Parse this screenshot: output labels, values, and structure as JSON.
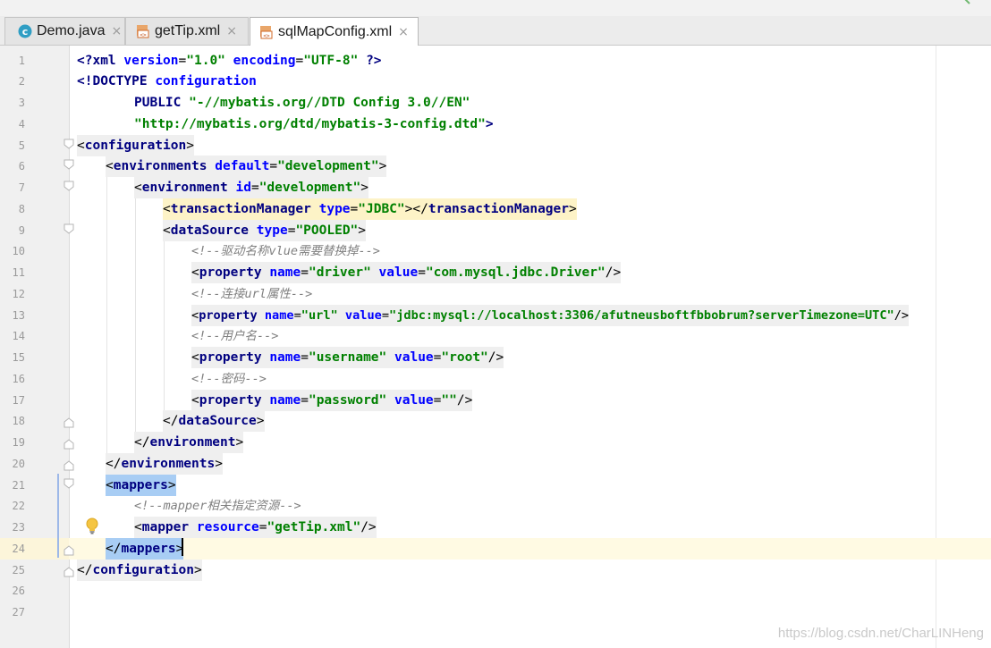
{
  "tabs": [
    {
      "label": "Demo.java",
      "icon": "java-class-icon",
      "active": false
    },
    {
      "label": "getTip.xml",
      "icon": "xml-file-icon",
      "active": false
    },
    {
      "label": "sqlMapConfig.xml",
      "icon": "xml-file-icon",
      "active": true
    }
  ],
  "tab_close_glyph": "×",
  "current_line": 24,
  "line_numbers": [
    "1",
    "2",
    "3",
    "4",
    "5",
    "6",
    "7",
    "8",
    "9",
    "10",
    "11",
    "12",
    "13",
    "14",
    "15",
    "16",
    "17",
    "18",
    "19",
    "20",
    "21",
    "22",
    "23",
    "24",
    "25",
    "26",
    "27"
  ],
  "code": {
    "l1": {
      "open": "<?",
      "kw": "xml",
      "a1": "version",
      "eq1": "=",
      "v1": "\"1.0\"",
      "a2": "encoding",
      "eq2": "=",
      "v2": "\"UTF-8\"",
      "close": "?>"
    },
    "l2": {
      "kw": "<!DOCTYPE",
      "name": "configuration"
    },
    "l3": {
      "kw": "PUBLIC",
      "v": "\"-//mybatis.org//DTD Config 3.0//EN\""
    },
    "l4": {
      "v": "\"http://mybatis.org/dtd/mybatis-3-config.dtd\"",
      "close": ">"
    },
    "l5": {
      "open": "<",
      "tag": "configuration",
      "close": ">"
    },
    "l6": {
      "open": "<",
      "tag": "environments",
      "a": "default",
      "eq": "=",
      "v": "\"development\"",
      "close": ">"
    },
    "l7": {
      "open": "<",
      "tag": "environment",
      "a": "id",
      "eq": "=",
      "v": "\"development\"",
      "close": ">"
    },
    "l8": {
      "open": "<",
      "tag": "transactionManager",
      "a": "type",
      "eq": "=",
      "v": "\"JDBC\"",
      "mid": "></",
      "tag2": "transactionManager",
      "close": ">"
    },
    "l9": {
      "open": "<",
      "tag": "dataSource",
      "a": "type",
      "eq": "=",
      "v": "\"POOLED\"",
      "close": ">"
    },
    "l10": {
      "comment": "<!--驱动名称vlue需要替换掉-->"
    },
    "l11": {
      "open": "<",
      "tag": "property",
      "a1": "name",
      "eq1": "=",
      "v1": "\"driver\"",
      "a2": "value",
      "eq2": "=",
      "v2": "\"com.mysql.jdbc.Driver\"",
      "close": "/>"
    },
    "l12": {
      "comment": "<!--连接url属性-->"
    },
    "l13": {
      "open": "<",
      "tag": "property",
      "a1": "name",
      "eq1": "=",
      "v1": "\"url\"",
      "a2": "value",
      "eq2": "=",
      "v2": "\"jdbc:mysql://localhost:3306/afutneusboftfbbobrum?serverTimezone=UTC\"",
      "close": "/>"
    },
    "l14": {
      "comment": "<!--用户名-->"
    },
    "l15": {
      "open": "<",
      "tag": "property",
      "a1": "name",
      "eq1": "=",
      "v1": "\"username\"",
      "a2": "value",
      "eq2": "=",
      "v2": "\"root\"",
      "close": "/>"
    },
    "l16": {
      "comment": "<!--密码-->"
    },
    "l17": {
      "open": "<",
      "tag": "property",
      "a1": "name",
      "eq1": "=",
      "v1": "\"password\"",
      "a2": "value",
      "eq2": "=",
      "v2": "\"\"",
      "close": "/>"
    },
    "l18": {
      "open": "</",
      "tag": "dataSource",
      "close": ">"
    },
    "l19": {
      "open": "</",
      "tag": "environment",
      "close": ">"
    },
    "l20": {
      "open": "</",
      "tag": "environments",
      "close": ">"
    },
    "l21": {
      "open": "<",
      "tag": "mappers",
      "close": ">"
    },
    "l22": {
      "comment": "<!--mapper相关指定资源-->"
    },
    "l23": {
      "open": "<",
      "tag": "mapper",
      "a": "resource",
      "eq": "=",
      "v": "\"getTip.xml\"",
      "close": "/>"
    },
    "l24": {
      "open": "</",
      "tag": "mappers",
      "close": ">"
    },
    "l25": {
      "open": "</",
      "tag": "configuration",
      "close": ">"
    }
  },
  "watermark": "https://blog.csdn.net/CharLINHeng",
  "colors": {
    "tag": "#000080",
    "attribute": "#0000ff",
    "value": "#008000",
    "comment": "#808080",
    "current_line": "#fffae3",
    "bracket_match": "#a8cdf4",
    "tag_highlight": "#fdf3c7"
  }
}
